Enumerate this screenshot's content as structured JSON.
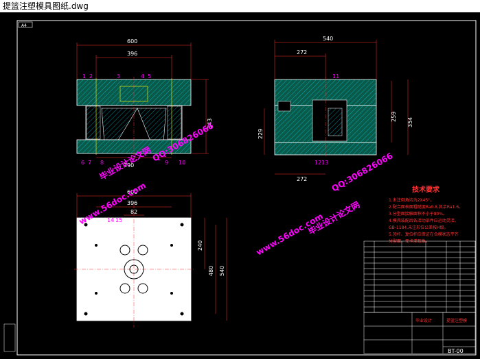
{
  "window": {
    "title": "提篮注塑模具图纸.dwg"
  },
  "drawing": {
    "frame_tag": "A4",
    "front_view": {
      "width_outer": "600",
      "width_inner": "396",
      "width_bottom": "390",
      "height": "343"
    },
    "side_view": {
      "width_outer": "540",
      "width_top": "272",
      "width_bottom": "272",
      "height_a": "259",
      "height_b": "354",
      "height_left": "229"
    },
    "plan_view": {
      "width_outer": "600",
      "width_inner": "396",
      "offset": "82",
      "height_a": "240",
      "height_b": "480",
      "height_c": "540"
    },
    "balloons": [
      "1",
      "2",
      "3",
      "4",
      "5",
      "6",
      "7",
      "8",
      "9",
      "10",
      "11",
      "12",
      "13",
      "14",
      "15"
    ],
    "tech_req": {
      "title": "技术要求",
      "lines": [
        "1.未注倒角均为2X45°。",
        "2.配合面表面粗糙度Ra0.8,其余Ra1.6。",
        "3.分型面接触面积不小于80%。",
        "4.模具装配后各活动部件应运动灵活。",
        "GB-1184,未注形位公差按H级。",
        "5.顶杆、复位杆应保证在合模状态平齐",
        "分型面，无卡滞现象。"
      ]
    },
    "title_block": {
      "part_no": "BT-00",
      "name": "提篮注塑模",
      "school": "毕业设计"
    },
    "watermarks": [
      "www.56doc.com",
      "QQ:306826066",
      "毕业设计论文网"
    ]
  }
}
